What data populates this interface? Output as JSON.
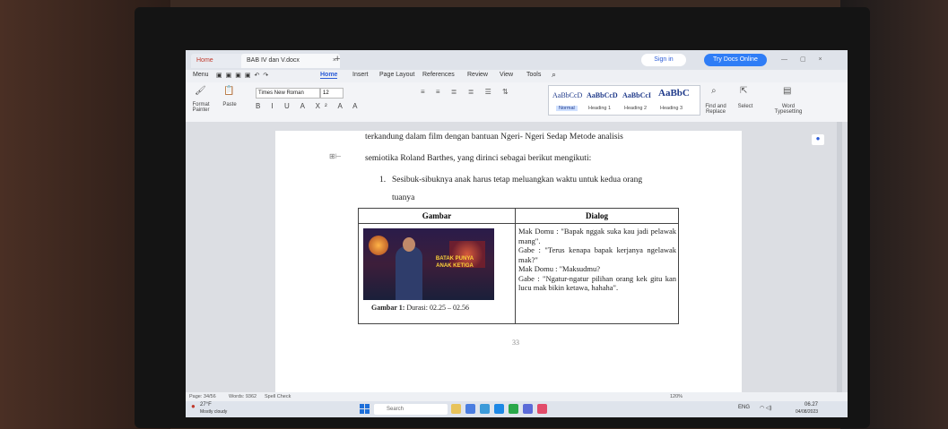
{
  "window": {
    "tabs": [
      {
        "label": "Home"
      },
      {
        "label": "BAB IV dan V.docx"
      }
    ],
    "sign_in": "Sign in",
    "use_doc": "Try Docs Online"
  },
  "menu": {
    "items": [
      "Menu",
      "Home",
      "Insert",
      "Page Layout",
      "References",
      "Review",
      "View",
      "Tools"
    ],
    "active": "Home"
  },
  "ribbon": {
    "format_painter": "Format Painter",
    "paste": "Paste",
    "font_name": "Times New Roman",
    "font_size": "12",
    "styles": [
      {
        "preview": "AaBbCcD",
        "name": "Normal"
      },
      {
        "preview": "AaBbCcD",
        "name": "Heading 1"
      },
      {
        "preview": "AaBbCcI",
        "name": "Heading 2"
      },
      {
        "preview": "AaBbC",
        "name": "Heading 3"
      }
    ],
    "find_replace": "Find and Replace",
    "select": "Select",
    "word_typesetting": "Word Typesetting"
  },
  "document": {
    "line1": "terkandung dalam film dengan bantuan Ngeri- Ngeri Sedap Metode analisis",
    "line2": "semiotika Roland Barthes, yang dirinci sebagai berikut mengikuti:",
    "list_item_number": "1.",
    "list_item_line1": "Sesibuk-sibuknya anak harus tetap meluangkan waktu untuk kedua orang",
    "list_item_line2": "tuanya",
    "table": {
      "col1_header": "Gambar",
      "col2_header": "Dialog",
      "caption_bold": "Gambar 1:",
      "caption_rest": " Durasi: 02.25 – 02.56",
      "poster_text": "BATAK PUNYA ANAK KETIGA",
      "dialog_lines": [
        "Mak Domu : \"Bapak nggak suka kau jadi pelawak mang\".",
        "Gabe : \"Terus kenapa bapak kerjanya ngelawak mak?\"",
        "Mak Domu : \"Maksudmu?",
        "Gabe : \"Ngatur-ngatur pilihan orang kek gitu kan lucu mak bikin ketawa, hahaha\"."
      ]
    },
    "page_number": "33"
  },
  "status": {
    "page": "Page: 34/56",
    "words": "Words: 9362",
    "spell": "Spell Check",
    "zoom": "120%"
  },
  "taskbar": {
    "weather_temp": "27°F",
    "weather_desc": "Mostly cloudy",
    "search_placeholder": "Search",
    "lang": "ENG",
    "time": "06.27",
    "date": "04/08/2023"
  }
}
